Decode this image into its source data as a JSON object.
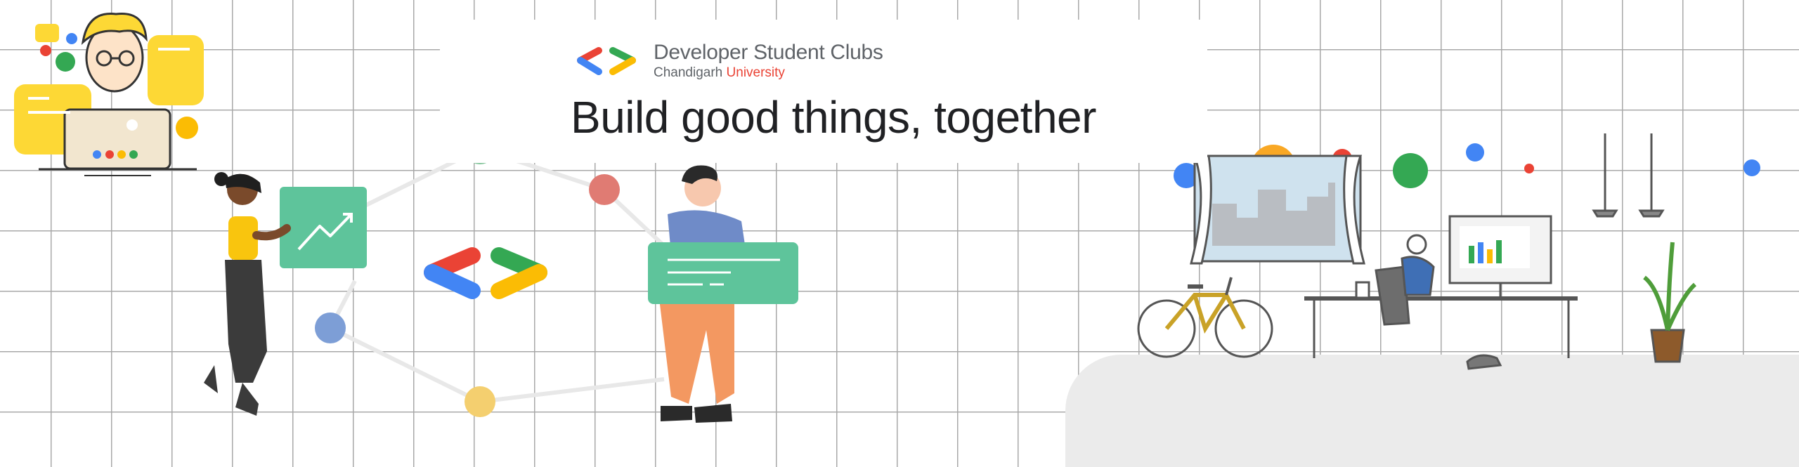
{
  "banner": {
    "brand_name": "Developer Student Clubs",
    "brand_sub_prefix": "Chandigarh",
    "brand_sub_suffix": "University",
    "tagline": "Build good things, together"
  },
  "colors": {
    "google_blue": "#4285f4",
    "google_red": "#ea4335",
    "google_yellow": "#fbbc04",
    "google_green": "#34a853",
    "card_green": "#5ec49b",
    "grid_line": "#a8a8a8",
    "floor": "#ebebeb"
  },
  "icons": [
    "dsc-logo-icon",
    "network-node-icon",
    "chart-card-icon",
    "dots-icon"
  ]
}
